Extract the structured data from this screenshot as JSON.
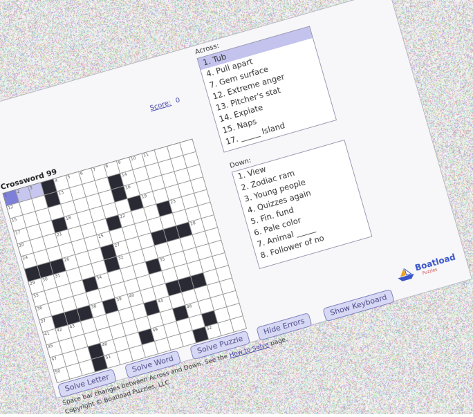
{
  "puzzle": {
    "title": "Crossword 99",
    "score_label": "Score:",
    "score_value": "0"
  },
  "grid": {
    "rows": [
      "...#...........",
      "...#....#......",
      "........#......",
      "...#.....#.....",
      ".......#...#...",
      "...............",
      "###...#...###..",
      "......#........",
      "....#....#.....",
      "...............",
      ".###.#....###..",
      "........#......",
      "..........#....",
      "...#...#....#..",
      "...#.......#..."
    ],
    "selected": [
      0,
      0
    ],
    "highlighted": [
      [
        0,
        1
      ],
      [
        0,
        2
      ]
    ],
    "numbers": [
      {
        "r": 0,
        "c": 0,
        "n": "1"
      },
      {
        "r": 0,
        "c": 1,
        "n": "2"
      },
      {
        "r": 0,
        "c": 2,
        "n": "3"
      },
      {
        "r": 0,
        "c": 4,
        "n": "4"
      },
      {
        "r": 0,
        "c": 5,
        "n": "5"
      },
      {
        "r": 0,
        "c": 6,
        "n": "6"
      },
      {
        "r": 0,
        "c": 7,
        "n": "7"
      },
      {
        "r": 0,
        "c": 8,
        "n": "8"
      },
      {
        "r": 0,
        "c": 9,
        "n": "9"
      },
      {
        "r": 0,
        "c": 10,
        "n": "10"
      },
      {
        "r": 0,
        "c": 11,
        "n": "11"
      },
      {
        "r": 1,
        "c": 0,
        "n": "12"
      },
      {
        "r": 1,
        "c": 4,
        "n": "13"
      },
      {
        "r": 1,
        "c": 9,
        "n": "14"
      },
      {
        "r": 2,
        "c": 0,
        "n": "15"
      },
      {
        "r": 2,
        "c": 9,
        "n": "16"
      },
      {
        "r": 3,
        "c": 0,
        "n": "17"
      },
      {
        "r": 3,
        "c": 4,
        "n": "18"
      },
      {
        "r": 3,
        "c": 10,
        "n": "19"
      },
      {
        "r": 4,
        "c": 0,
        "n": "20"
      },
      {
        "r": 4,
        "c": 3,
        "n": "21"
      },
      {
        "r": 4,
        "c": 8,
        "n": "22"
      },
      {
        "r": 4,
        "c": 12,
        "n": "23"
      },
      {
        "r": 5,
        "c": 0,
        "n": "24"
      },
      {
        "r": 5,
        "c": 6,
        "n": "25"
      },
      {
        "r": 6,
        "c": 3,
        "n": "26"
      },
      {
        "r": 6,
        "c": 7,
        "n": "27"
      },
      {
        "r": 6,
        "c": 13,
        "n": "28"
      },
      {
        "r": 7,
        "c": 0,
        "n": "29"
      },
      {
        "r": 7,
        "c": 1,
        "n": "30"
      },
      {
        "r": 7,
        "c": 2,
        "n": "31"
      },
      {
        "r": 7,
        "c": 7,
        "n": "32"
      },
      {
        "r": 8,
        "c": 0,
        "n": "33"
      },
      {
        "r": 8,
        "c": 5,
        "n": "34"
      },
      {
        "r": 8,
        "c": 10,
        "n": "35"
      },
      {
        "r": 9,
        "c": 0,
        "n": "36"
      },
      {
        "r": 10,
        "c": 0,
        "n": "37"
      },
      {
        "r": 10,
        "c": 4,
        "n": "38"
      },
      {
        "r": 10,
        "c": 6,
        "n": "39"
      },
      {
        "r": 10,
        "c": 7,
        "n": "40"
      },
      {
        "r": 11,
        "c": 0,
        "n": "41"
      },
      {
        "r": 11,
        "c": 1,
        "n": "42"
      },
      {
        "r": 11,
        "c": 2,
        "n": "43"
      },
      {
        "r": 11,
        "c": 9,
        "n": "44"
      },
      {
        "r": 12,
        "c": 0,
        "n": "45"
      },
      {
        "r": 12,
        "c": 11,
        "n": "46"
      },
      {
        "r": 13,
        "c": 0,
        "n": "47"
      },
      {
        "r": 13,
        "c": 4,
        "n": "48"
      },
      {
        "r": 13,
        "c": 8,
        "n": "49"
      },
      {
        "r": 14,
        "c": 0,
        "n": "50"
      },
      {
        "r": 14,
        "c": 4,
        "n": "51"
      },
      {
        "r": 14,
        "c": 12,
        "n": "52"
      }
    ]
  },
  "across": {
    "heading": "Across:",
    "clues": [
      "1. Tub",
      "4. Pull apart",
      "7. Gem surface",
      "12. Extreme anger",
      "13. Pitcher's stat",
      "14. Expiate",
      "15. Naps",
      "17. _____ Island"
    ]
  },
  "down": {
    "heading": "Down:",
    "clues": [
      "1. View",
      "2. Zodiac ram",
      "3. Young people",
      "4. Quizzes again",
      "5. Fin. fund",
      "6. Pale color",
      "7. Animal _____",
      "8. Follower of no"
    ]
  },
  "buttons": {
    "solve_letter": "Solve Letter",
    "solve_word": "Solve Word",
    "solve_puzzle": "Solve Puzzle",
    "hide_errors": "Hide Errors",
    "show_keyboard": "Show Keyboard"
  },
  "logo": {
    "name": "Boatload",
    "sub": "Puzzles"
  },
  "footer": {
    "line1_a": "Space bar changes between Across and Down. See the ",
    "line1_link": "How to Solve",
    "line1_b": " page.",
    "line2": "Copyright © Boatload Puzzles, LLC"
  },
  "colors": {
    "selected_cell": "#7d7fd8",
    "highlighted_cell": "#c6c6ee",
    "black_cell": "#2a2a35",
    "button_bg": "#d7d8f4",
    "link": "#4444aa"
  }
}
